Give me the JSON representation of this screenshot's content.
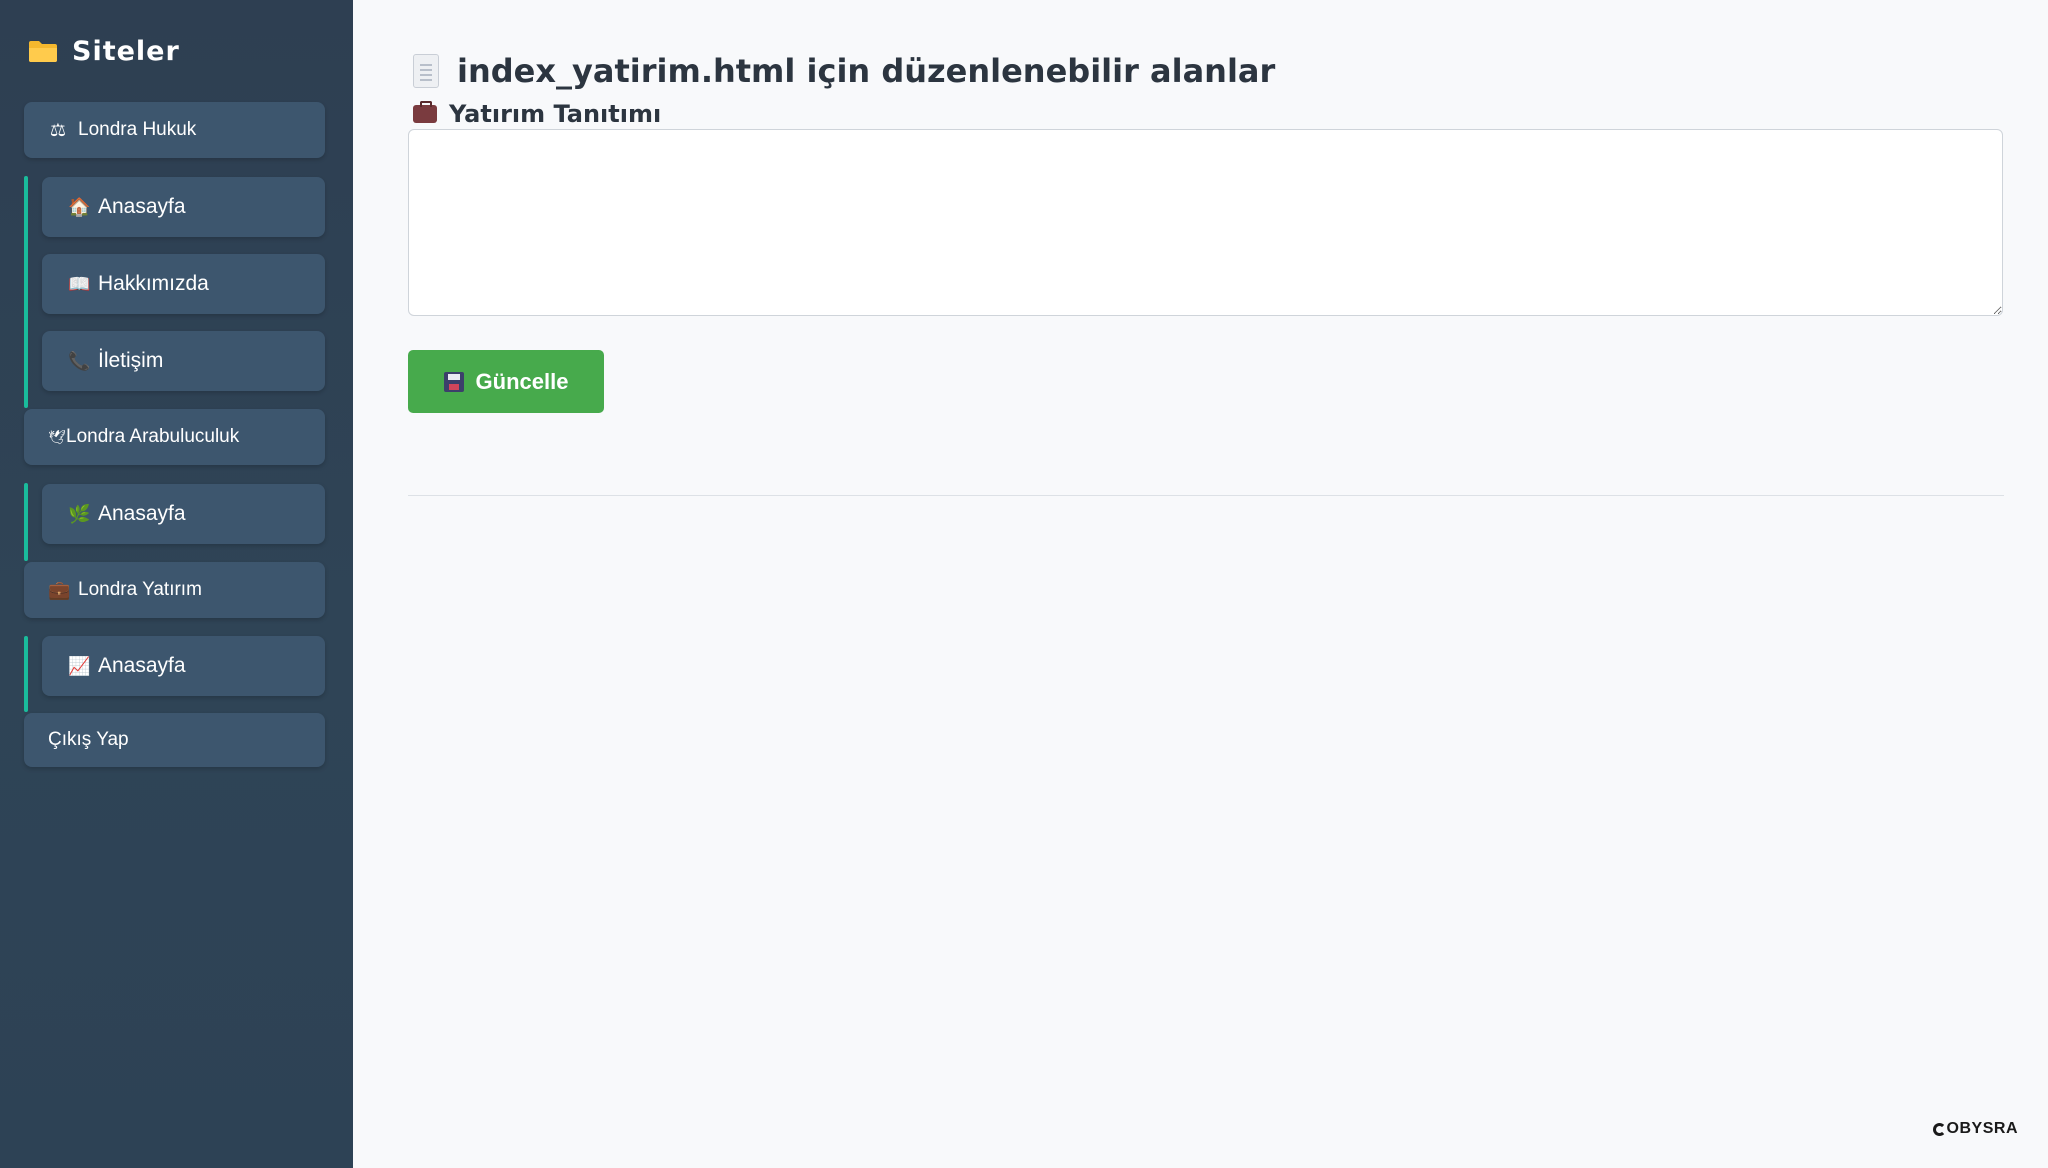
{
  "sidebar": {
    "title": "Siteler",
    "sites": [
      {
        "label": "Londra Hukuk",
        "icon": "balance-scale-icon",
        "pages": [
          {
            "label": "Anasayfa",
            "icon": "house-icon"
          },
          {
            "label": "Hakkımızda",
            "icon": "open-book-icon"
          },
          {
            "label": "İletişim",
            "icon": "telephone-icon"
          }
        ]
      },
      {
        "label": "Londra Arabuluculuk",
        "icon": "dove-icon",
        "pages": [
          {
            "label": "Anasayfa",
            "icon": "herb-icon"
          }
        ]
      },
      {
        "label": "Londra Yatırım",
        "icon": "briefcase-icon",
        "pages": [
          {
            "label": "Anasayfa",
            "icon": "chart-increasing-icon"
          }
        ]
      }
    ],
    "logout_label": "Çıkış Yap"
  },
  "main": {
    "heading": "index_yatirim.html için düzenlenebilir alanlar",
    "field_label": "Yatırım Tanıtımı",
    "field_value": "",
    "update_label": "Güncelle"
  },
  "brand": {
    "name": "OBYSRA"
  },
  "colors": {
    "sidebar_bg": "#2f4456",
    "button_bg": "#3d566e",
    "accent": "#1abc9c",
    "update_button": "#47aa4c",
    "page_bg": "#f8f9fb"
  }
}
